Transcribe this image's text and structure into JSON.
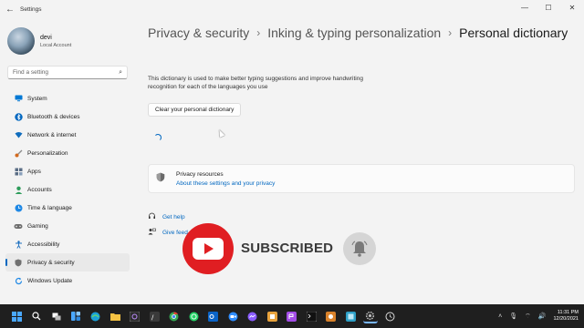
{
  "window": {
    "title": "Settings",
    "back_icon": "back-arrow-icon",
    "minimize_glyph": "—",
    "maximize_glyph": "☐",
    "close_glyph": "✕"
  },
  "profile": {
    "name": "devi",
    "account_type": "Local Account"
  },
  "search": {
    "placeholder": "Find a setting",
    "icon": "search-icon"
  },
  "sidebar": {
    "items": [
      {
        "label": "System",
        "icon": "monitor-icon",
        "color": "#0078d4"
      },
      {
        "label": "Bluetooth & devices",
        "icon": "bluetooth-icon",
        "color": "#0067c0"
      },
      {
        "label": "Network & internet",
        "icon": "wifi-icon",
        "color": "#0f6cbd"
      },
      {
        "label": "Personalization",
        "icon": "brush-icon",
        "color": "#d2691e"
      },
      {
        "label": "Apps",
        "icon": "apps-icon",
        "color": "#5a6d85"
      },
      {
        "label": "Accounts",
        "icon": "person-icon",
        "color": "#2e9d5b"
      },
      {
        "label": "Time & language",
        "icon": "globe-clock-icon",
        "color": "#1e88e5"
      },
      {
        "label": "Gaming",
        "icon": "gamepad-icon",
        "color": "#6d6d6d"
      },
      {
        "label": "Accessibility",
        "icon": "accessibility-icon",
        "color": "#1c6fbf"
      },
      {
        "label": "Privacy & security",
        "icon": "shield-icon",
        "color": "#707070",
        "active": true
      },
      {
        "label": "Windows Update",
        "icon": "update-icon",
        "color": "#1e88e5"
      }
    ]
  },
  "breadcrumb": {
    "items": [
      "Privacy & security",
      "Inking & typing personalization"
    ],
    "separator": "›",
    "current": "Personal dictionary"
  },
  "main": {
    "description": "This dictionary is used to make better typing suggestions and improve handwriting recognition for each of the languages you use",
    "clear_button_label": "Clear your personal dictionary"
  },
  "resources": {
    "title": "Privacy resources",
    "link": "About these settings and your privacy"
  },
  "help": {
    "get_help": "Get help",
    "give_feedback": "Give feed"
  },
  "overlay": {
    "subscribed_text": "SUBSCRIBED",
    "brand_color": "#e01e22"
  },
  "taskbar": {
    "icons": [
      "windows-start-icon",
      "search-icon",
      "task-view-icon",
      "widgets-icon",
      "edge-icon",
      "file-explorer-icon",
      "app-icon",
      "app-icon",
      "chrome-icon",
      "whatsapp-icon",
      "outlook-icon",
      "zoom-icon",
      "messenger-icon",
      "app-icon",
      "app-icon",
      "terminal-icon",
      "app-icon",
      "app-icon",
      "settings-icon",
      "app-icon"
    ],
    "time": "11:31 PM",
    "date": "12/20/2021"
  }
}
